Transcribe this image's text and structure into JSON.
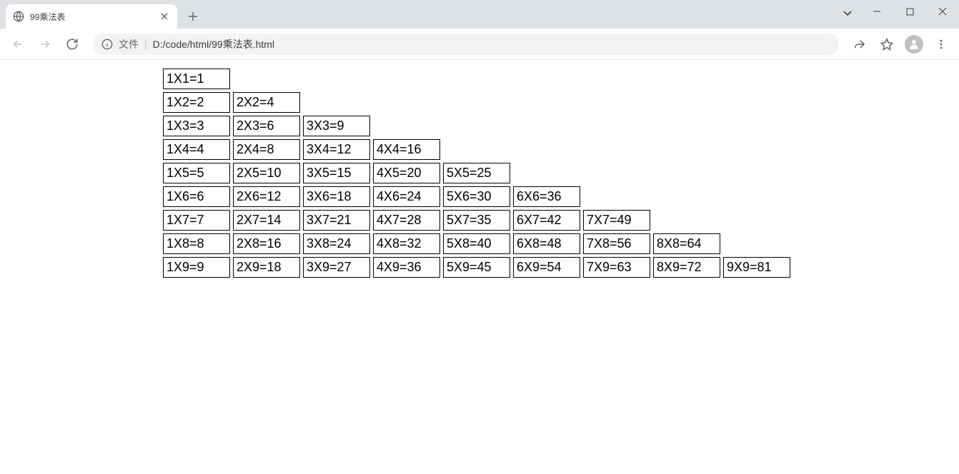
{
  "browser": {
    "tab_title": "99乘法表",
    "address_prefix": "文件",
    "address_path": "D:/code/html/99乘法表.html"
  },
  "table": {
    "rows": [
      [
        "1X1=1"
      ],
      [
        "1X2=2",
        "2X2=4"
      ],
      [
        "1X3=3",
        "2X3=6",
        "3X3=9"
      ],
      [
        "1X4=4",
        "2X4=8",
        "3X4=12",
        "4X4=16"
      ],
      [
        "1X5=5",
        "2X5=10",
        "3X5=15",
        "4X5=20",
        "5X5=25"
      ],
      [
        "1X6=6",
        "2X6=12",
        "3X6=18",
        "4X6=24",
        "5X6=30",
        "6X6=36"
      ],
      [
        "1X7=7",
        "2X7=14",
        "3X7=21",
        "4X7=28",
        "5X7=35",
        "6X7=42",
        "7X7=49"
      ],
      [
        "1X8=8",
        "2X8=16",
        "3X8=24",
        "4X8=32",
        "5X8=40",
        "6X8=48",
        "7X8=56",
        "8X8=64"
      ],
      [
        "1X9=9",
        "2X9=18",
        "3X9=27",
        "4X9=36",
        "5X9=45",
        "6X9=54",
        "7X9=63",
        "8X9=72",
        "9X9=81"
      ]
    ]
  }
}
